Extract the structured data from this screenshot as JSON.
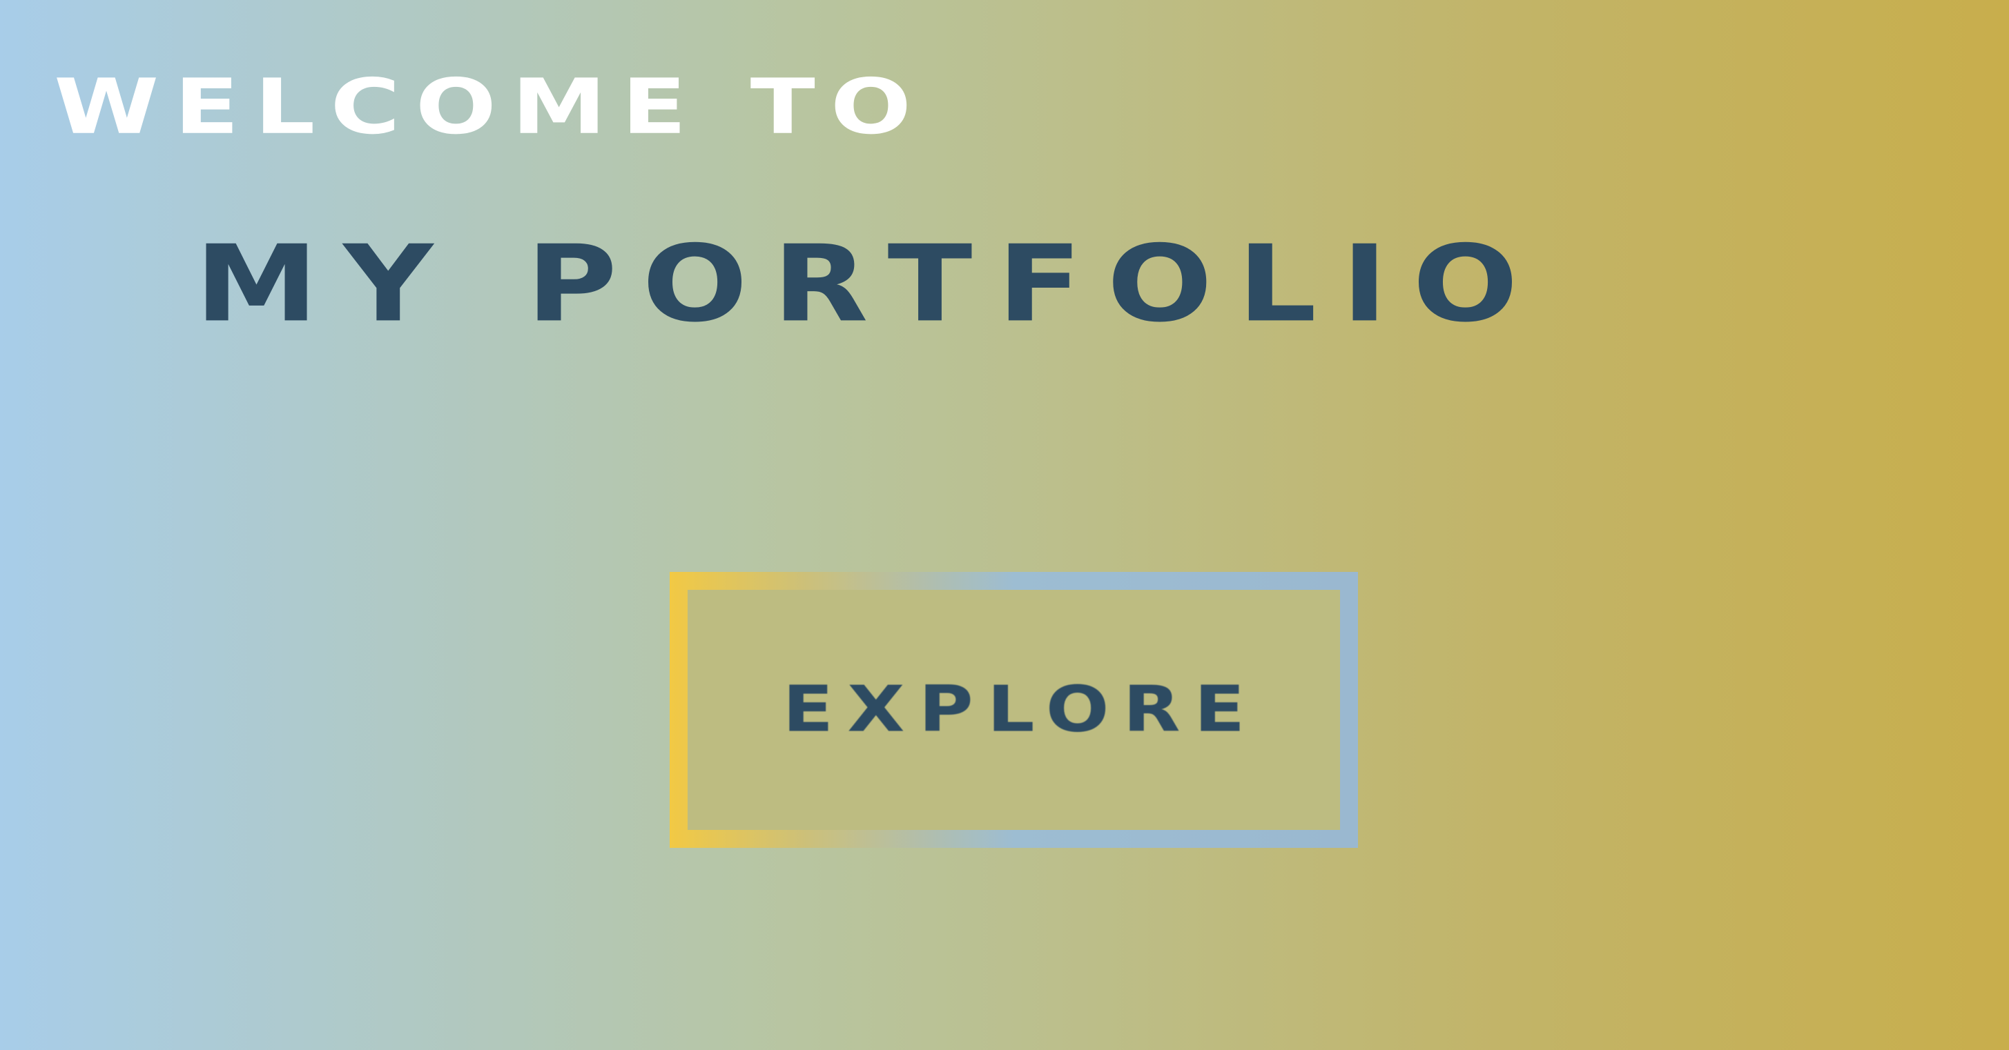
{
  "hero": {
    "greeting": "WELCOME TO",
    "title": "MY PORTFOLIO",
    "explore_label": "EXPLORE"
  },
  "colors": {
    "greeting_text": "#ffffff",
    "title_text": "#2d4b62",
    "background_left": "#a8cde9",
    "background_right": "#c8ae4c",
    "button_border_left": "#f2c944",
    "button_border_right": "#9ab8d0"
  }
}
